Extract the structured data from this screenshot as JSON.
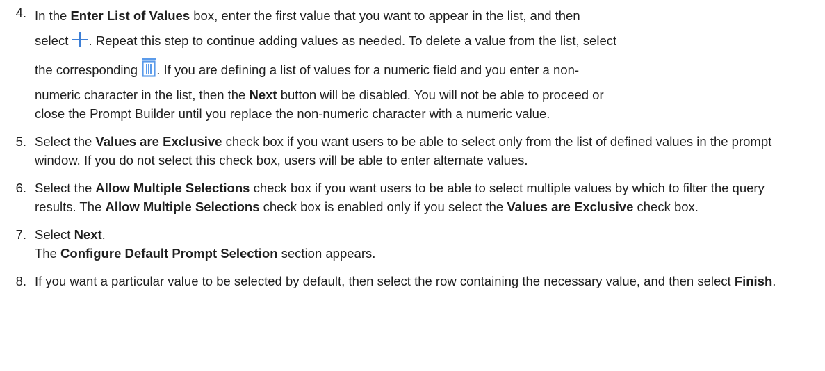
{
  "steps": [
    {
      "number": "4.",
      "lines": {
        "l1_pre": "In the ",
        "l1_bold": "Enter List of Values",
        "l1_post": " box, enter the first value that you want to appear in the list, and then",
        "l2_pre": "select ",
        "l2_post": ". Repeat this step to continue adding values as needed. To delete a value from the list, select",
        "l3_pre": "the corresponding ",
        "l3_post": ". If you are defining a list of values for a numeric field and you enter a non-",
        "l4_pre": "numeric character in the list, then the ",
        "l4_bold": "Next",
        "l4_post": " button will be disabled. You will not be able to proceed or",
        "l5": "close the Prompt Builder until you replace the non-numeric character with a numeric value."
      },
      "icons": [
        "plus-icon",
        "trash-icon"
      ]
    },
    {
      "number": "5.",
      "pre": "Select the ",
      "bold": "Values are Exclusive",
      "post": " check box if you want users to be able to select only from the list of defined values in the prompt window. If you do not select this check box, users will be able to enter alternate values."
    },
    {
      "number": "6.",
      "pre": "Select the ",
      "bold1": "Allow Multiple Selections",
      "mid1": " check box if you want users to be able to select multiple values by which to filter the query results. The ",
      "bold2": "Allow Multiple Selections",
      "mid2": " check box is enabled only if you select the ",
      "bold3": "Values are Exclusive",
      "post": " check box."
    },
    {
      "number": "7.",
      "pre": "Select ",
      "bold": "Next",
      "post": ".",
      "result_pre": "The ",
      "result_bold": "Configure Default Prompt Selection",
      "result_post": " section appears."
    },
    {
      "number": "8.",
      "pre": "If you want a particular value to be selected by default, then select the row containing the necessary value, and then select ",
      "bold": "Finish",
      "post": "."
    }
  ],
  "colors": {
    "icon_blue": "#3d7fd6",
    "text": "#1f1f1f"
  }
}
